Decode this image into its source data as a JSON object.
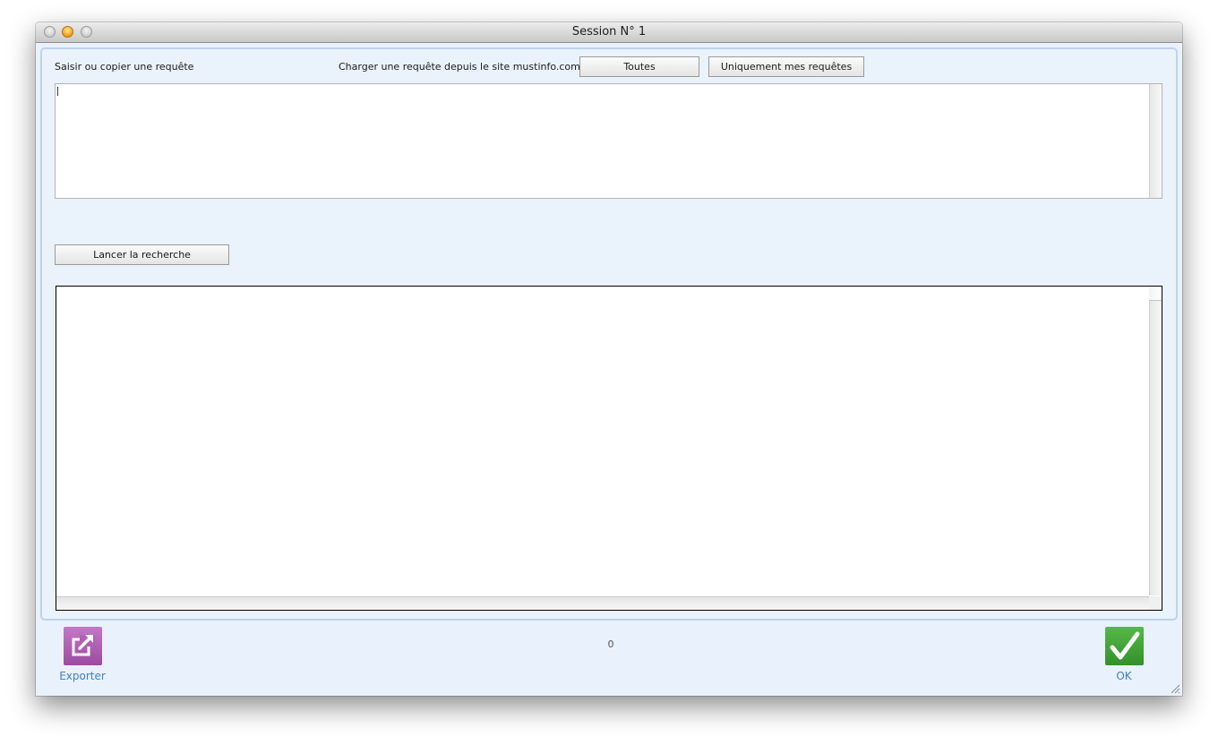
{
  "window": {
    "title": "Session N° 1"
  },
  "query": {
    "label": "Saisir ou copier une requête",
    "load_label": "Charger une requête depuis le site mustinfo.com :",
    "all_button": "Toutes",
    "mine_button": "Uniquement mes requêtes",
    "value": ""
  },
  "search": {
    "button": "Lancer la recherche"
  },
  "footer": {
    "export_label": "Exporter",
    "count": "0",
    "ok_label": "OK"
  },
  "colors": {
    "export_icon": "#b160b4",
    "ok_icon": "#3f9e35",
    "footer_label": "#3d82c0",
    "window_bg": "#e9f1fc"
  }
}
